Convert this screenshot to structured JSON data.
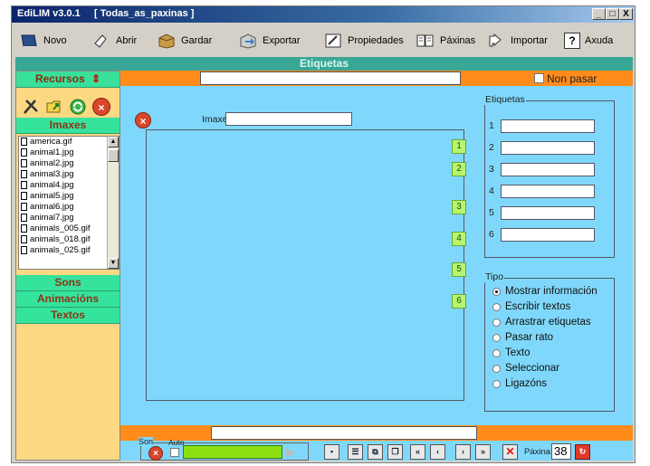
{
  "window": {
    "title": "EdiLIM v3.0.1",
    "page_tab": "[ Todas_as_paxinas ]",
    "min": "_",
    "max": "□",
    "close": "X"
  },
  "toolbar": {
    "novo": "Novo",
    "abrir": "Abrir",
    "gardar": "Gardar",
    "exportar": "Exportar",
    "propiedades": "Propiedades",
    "paxinas": "Páxinas",
    "importar": "Importar",
    "axuda": "Axuda"
  },
  "banner": "Etiquetas",
  "left": {
    "recursos": "Recursos",
    "imaxes": "Imaxes",
    "files": [
      "america.gif",
      "animal1.jpg",
      "animal2.jpg",
      "animal3.jpg",
      "animal4.jpg",
      "animal5.jpg",
      "animal6.jpg",
      "animal7.jpg",
      "animals_005.gif",
      "animals_018.gif",
      "animals_025.gif"
    ],
    "sons": "Sons",
    "animacions": "Animacións",
    "textos": "Textos"
  },
  "main": {
    "title_input": "",
    "non_pasar": "Non pasar",
    "imaxe_label": "Imaxe",
    "imaxe_value": "",
    "labels": [
      "1",
      "2",
      "3",
      "4",
      "5",
      "6"
    ],
    "etiquetas_title": "Etiquetas",
    "etiquetas_nums": [
      "1",
      "2",
      "3",
      "4",
      "5",
      "6"
    ],
    "tipo_title": "Tipo",
    "tipo_options": [
      {
        "label": "Mostrar información",
        "checked": true
      },
      {
        "label": "Escribir textos",
        "checked": false
      },
      {
        "label": "Arrastrar etiquetas",
        "checked": false
      },
      {
        "label": "Pasar rato",
        "checked": false
      },
      {
        "label": "Texto",
        "checked": false
      },
      {
        "label": "Seleccionar",
        "checked": false
      },
      {
        "label": "Ligazóns",
        "checked": false
      }
    ],
    "bottom_input": ""
  },
  "footer": {
    "son": "Son",
    "auto": "Auto",
    "paxina_label": "Páxina",
    "paxina_value": "38"
  },
  "colors": {
    "banner": "#39a795",
    "left_bg": "#fdd883",
    "main_bg": "#7fd8fb",
    "orange": "#ff8c1a",
    "section": "#39e09a"
  }
}
